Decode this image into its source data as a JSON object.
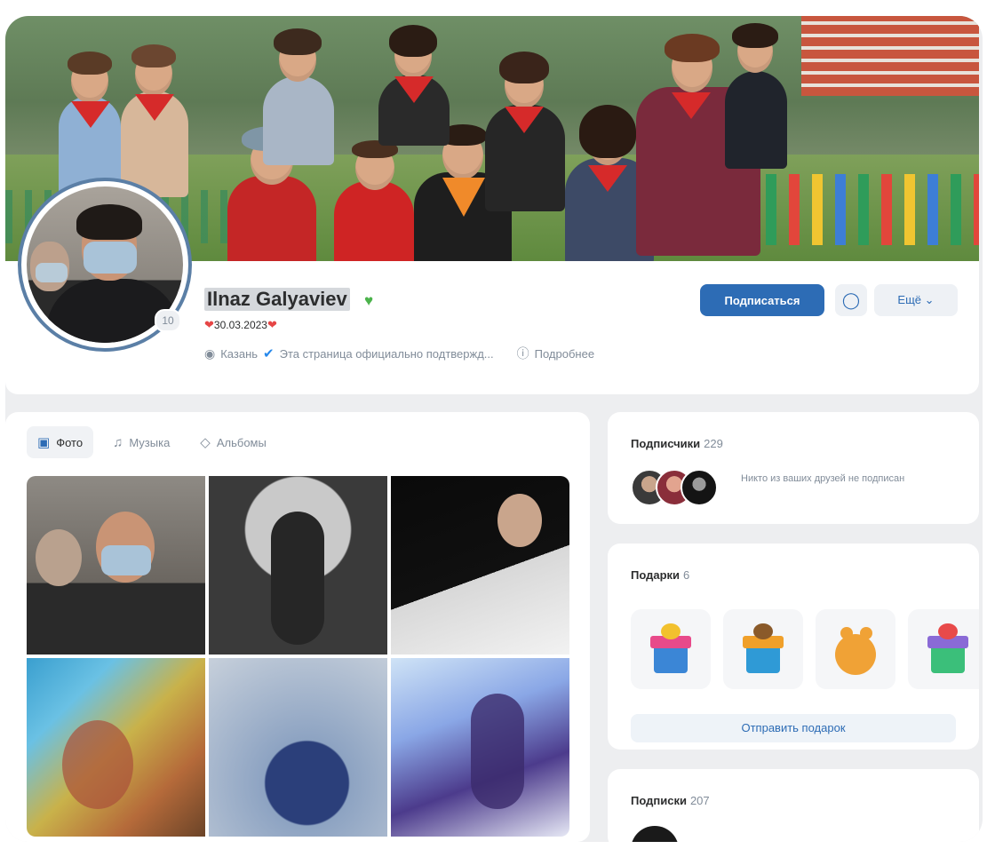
{
  "profile": {
    "name": "Ilnaz Galyaviev",
    "status": "30.03.2023",
    "city": "Казань",
    "verified_text": "Эта страница официально подтвержд...",
    "details_label": "Подробнее",
    "avatar_badge": "10"
  },
  "actions": {
    "subscribe_label": "Подписаться",
    "more_label": "Ещё"
  },
  "tabs": [
    {
      "label": "Фото",
      "icon": "photo-icon",
      "active": true
    },
    {
      "label": "Музыка",
      "icon": "music-icon",
      "active": false
    },
    {
      "label": "Альбомы",
      "icon": "albums-icon",
      "active": false
    }
  ],
  "followers": {
    "title": "Подписчики",
    "count": "229",
    "note": "Никто из ваших друзей не подписан"
  },
  "gifts": {
    "title": "Подарки",
    "count": "6",
    "send_label": "Отправить подарок"
  },
  "subscriptions": {
    "title": "Подписки",
    "count": "207",
    "first_item": "..."
  },
  "colors": {
    "accent": "#2d6cb5",
    "verified": "#4bb34b",
    "background": "#edeef0"
  }
}
